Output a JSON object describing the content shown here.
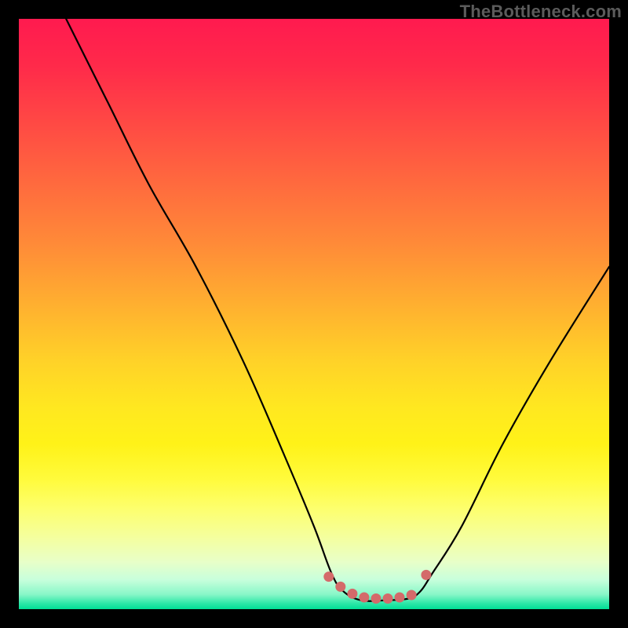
{
  "watermark": "TheBottleneck.com",
  "chart_data": {
    "type": "line",
    "title": "",
    "xlabel": "",
    "ylabel": "",
    "xlim": [
      0,
      100
    ],
    "ylim": [
      0,
      100
    ],
    "grid": false,
    "legend": false,
    "series": [
      {
        "name": "bottleneck-curve",
        "x": [
          8,
          15,
          22,
          30,
          38,
          45,
          50,
          53,
          55,
          58,
          62,
          66,
          68,
          70,
          75,
          82,
          90,
          100
        ],
        "y": [
          100,
          86,
          72,
          58,
          42,
          26,
          14,
          6,
          3,
          1.5,
          1.5,
          1.8,
          3,
          6,
          14,
          28,
          42,
          58
        ]
      }
    ],
    "markers": [
      {
        "name": "flat-region-dot",
        "x": 52.5,
        "y": 5.5
      },
      {
        "name": "flat-region-dot",
        "x": 54.5,
        "y": 3.8
      },
      {
        "name": "flat-region-dot",
        "x": 56.5,
        "y": 2.6
      },
      {
        "name": "flat-region-dot",
        "x": 58.5,
        "y": 2.0
      },
      {
        "name": "flat-region-dot",
        "x": 60.5,
        "y": 1.8
      },
      {
        "name": "flat-region-dot",
        "x": 62.5,
        "y": 1.8
      },
      {
        "name": "flat-region-dot",
        "x": 64.5,
        "y": 2.0
      },
      {
        "name": "flat-region-dot",
        "x": 66.5,
        "y": 2.4
      },
      {
        "name": "flat-region-dot",
        "x": 69.0,
        "y": 5.8
      }
    ],
    "colors": {
      "curve": "#000000",
      "marker": "#d46a6a"
    }
  }
}
